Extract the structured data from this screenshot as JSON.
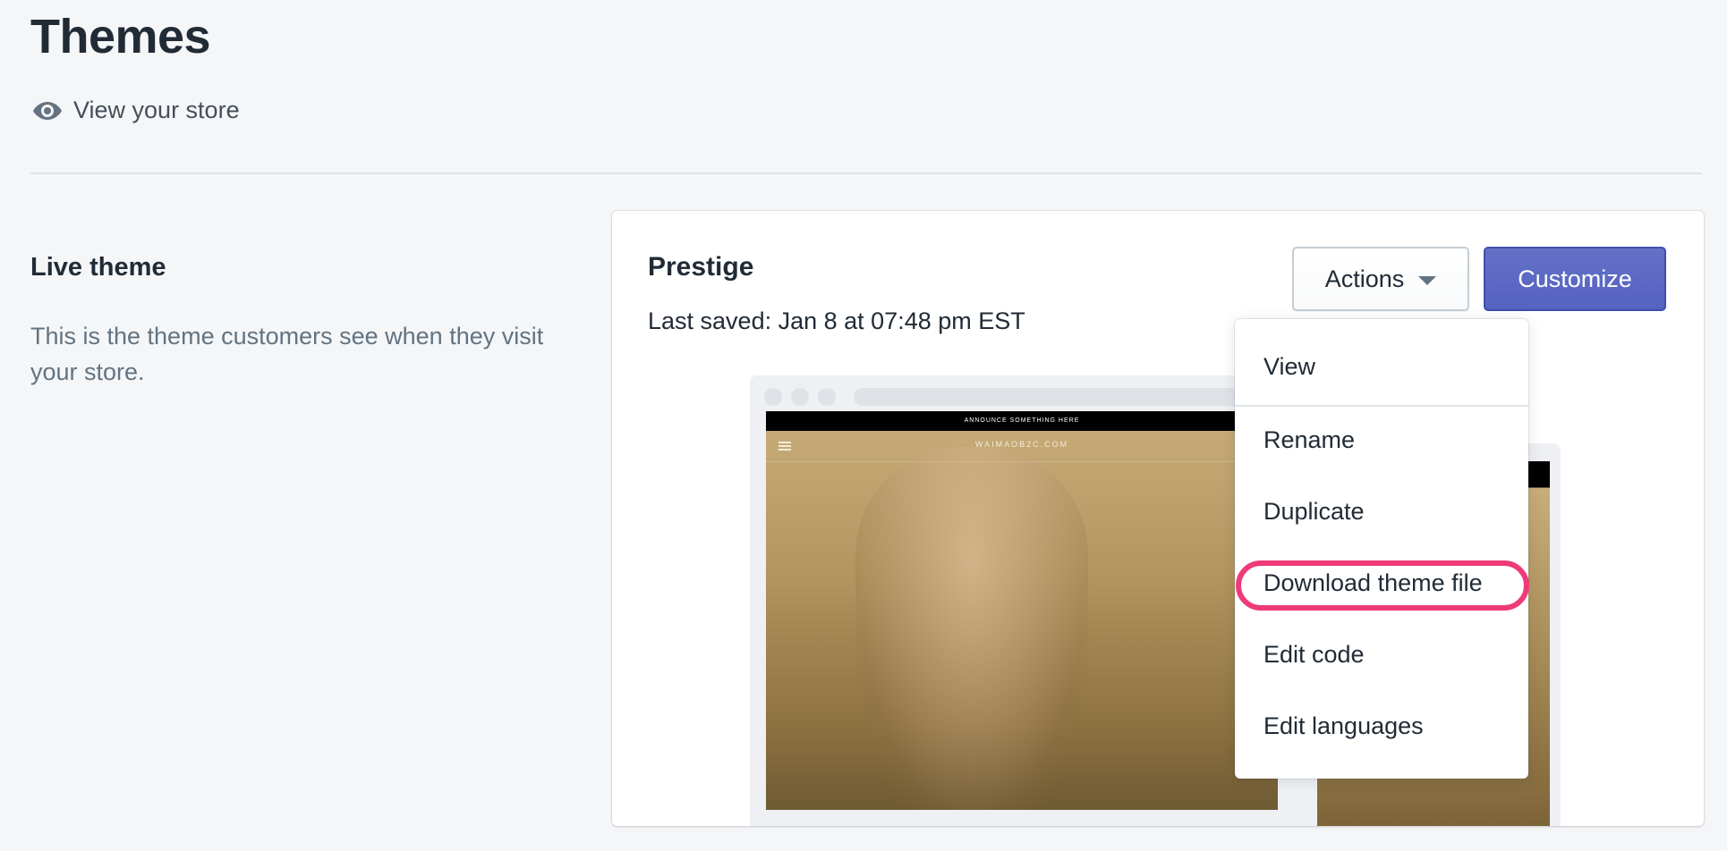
{
  "header": {
    "title": "Themes",
    "view_store_label": "View your store",
    "view_store_icon": "eye-icon"
  },
  "live_theme_section": {
    "heading": "Live theme",
    "description": "This is the theme customers see when they visit your store."
  },
  "theme_card": {
    "name": "Prestige",
    "last_saved": "Last saved: Jan 8 at 07:48 pm EST",
    "actions_label": "Actions",
    "customize_label": "Customize",
    "preview": {
      "announcement": "ANNOUNCE SOMETHING HERE",
      "site_name": "WAIMAOB2C.COM"
    }
  },
  "actions_menu": {
    "items": [
      {
        "label": "View"
      },
      {
        "label": "Rename"
      },
      {
        "label": "Duplicate"
      },
      {
        "label": "Download theme file",
        "highlighted": true
      },
      {
        "label": "Edit code"
      },
      {
        "label": "Edit languages"
      }
    ]
  },
  "colors": {
    "background": "#f4f6f8",
    "primary_button": "#5c6ac4",
    "highlight_ring": "#ef3a7a",
    "text": "#212b36",
    "subdued_text": "#637381"
  }
}
